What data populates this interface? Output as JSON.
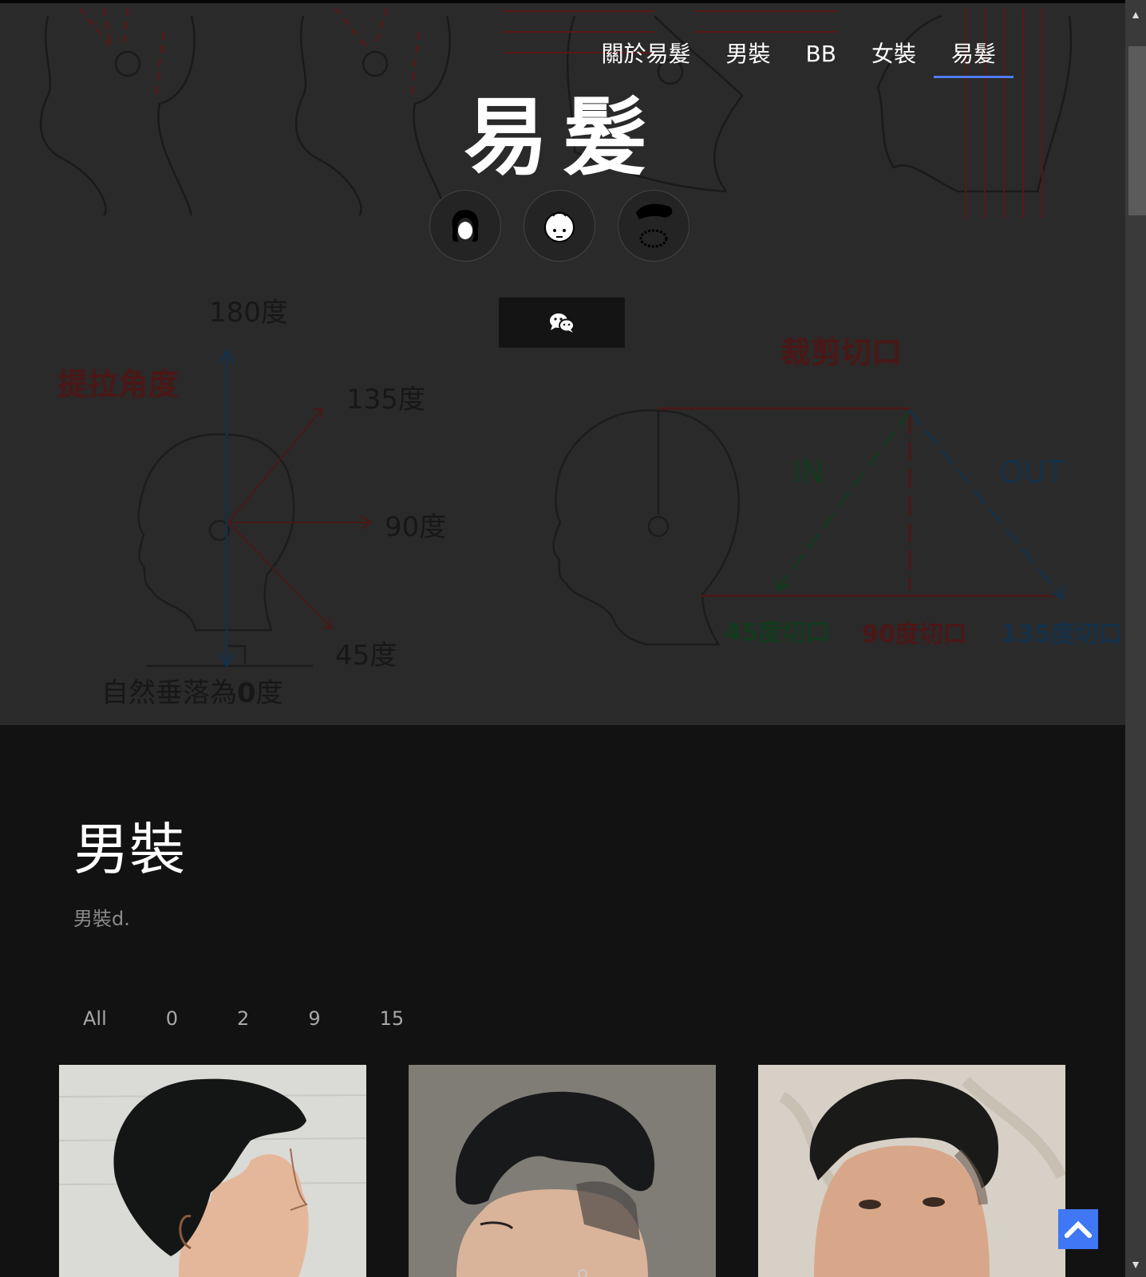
{
  "header": {
    "nav": [
      {
        "label": "關於易髮",
        "active": false
      },
      {
        "label": "男裝",
        "active": false
      },
      {
        "label": "BB",
        "active": false
      },
      {
        "label": "女裝",
        "active": false
      },
      {
        "label": "易髮",
        "active": true
      }
    ],
    "site_title": "易髮",
    "avatar_icons": [
      "woman-hair-icon",
      "baby-face-icon",
      "man-beard-icon"
    ],
    "wechat_icon": "wechat-icon",
    "accent_color": "#4f7dff"
  },
  "hero_diagram": {
    "left": {
      "title": "提拉角度",
      "angles": [
        "180度",
        "135度",
        "90度",
        "45度"
      ],
      "bottom_label_prefix": "自然垂落為",
      "bottom_label_number": "0",
      "bottom_label_suffix": "度"
    },
    "right": {
      "title": "裁剪切口",
      "in_label": "IN",
      "out_label": "OUT",
      "cuts": [
        "45度切口",
        "90度切口",
        "135度切口"
      ]
    }
  },
  "section": {
    "title": "男裝",
    "description": "男裝d.",
    "filters": [
      "All",
      "0",
      "2",
      "9",
      "15"
    ]
  },
  "gallery": [
    {
      "alt": "male-haircut-photo-1"
    },
    {
      "alt": "male-haircut-photo-2"
    },
    {
      "alt": "male-haircut-photo-3"
    }
  ],
  "scroll": {
    "up": "▲",
    "down": "▼"
  }
}
